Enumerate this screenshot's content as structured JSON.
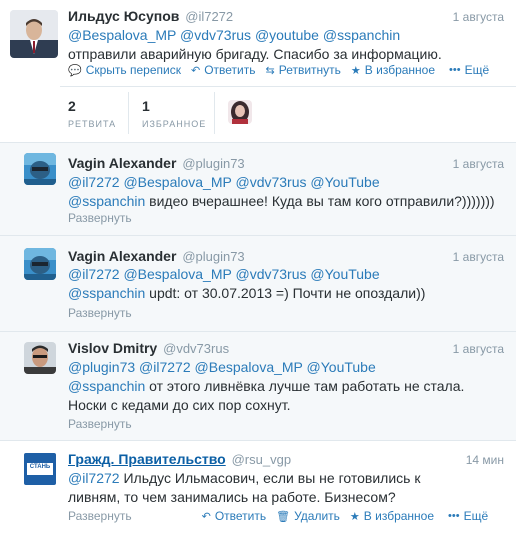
{
  "main_tweet": {
    "name": "Ильдус Юсупов",
    "username": "@il7272",
    "time": "1 августа",
    "mentions": [
      "@Bespalova_MP",
      "@vdv73rus",
      "@youtube",
      "@sspanchin"
    ],
    "text": "отправили аварийную бригаду. Спасибо за информацию.",
    "actions": {
      "hide_conversation": "Скрыть переписк",
      "reply": "Ответить",
      "retweet": "Ретвитнуть",
      "favorite": "В избранное",
      "more": "Ещё"
    },
    "stats": {
      "retweets_count": "2",
      "retweets_label": "РЕТВИТА",
      "favorites_count": "1",
      "favorites_label": "ИЗБРАННОЕ"
    }
  },
  "replies": [
    {
      "name": "Vagin Alexander",
      "username": "@plugin73",
      "time": "1 августа",
      "line1_mentions": [
        "@il7272",
        "@Bespalova_MP",
        "@vdv73rus",
        "@YouTube"
      ],
      "line2_mention": "@sspanchin",
      "line2_text": " видео вчерашнее! Куда вы там кого отправили?)))))))",
      "expand": "Развернуть"
    },
    {
      "name": "Vagin Alexander",
      "username": "@plugin73",
      "time": "1 августа",
      "line1_mentions": [
        "@il7272",
        "@Bespalova_MP",
        "@vdv73rus",
        "@YouTube"
      ],
      "line2_mention": "@sspanchin",
      "line2_text": " updt: от 30.07.2013 =) Почти не опоздали))",
      "expand": "Развернуть"
    },
    {
      "name": "Vislov Dmitry",
      "username": "@vdv73rus",
      "time": "1 августа",
      "line1_mentions": [
        "@plugin73",
        "@il7272",
        "@Bespalova_MP",
        "@YouTube"
      ],
      "line2_mention": "@sspanchin",
      "line2_text": " от этого ливнёвка лучше там работать не стала.",
      "line3_text": "Носки с кедами до сих пор сохнут.",
      "expand": "Развернуть"
    }
  ],
  "last_tweet": {
    "name": "Гражд. Правительство",
    "username": "@rsu_vgp",
    "time": "14 мин",
    "avatar_text": "СТАНЬ",
    "mention": "@il7272",
    "text1": " Ильдус Ильмасович, если вы не готовились к",
    "text2": "ливням, то чем занимались на работе. Бизнесом?",
    "expand": "Развернуть",
    "actions": {
      "reply": "Ответить",
      "delete": "Удалить",
      "favorite": "В избранное",
      "more": "Ещё"
    }
  },
  "colors": {
    "link": "#2b7bb9",
    "muted": "#8899a6",
    "divider": "#e1e8ed"
  }
}
